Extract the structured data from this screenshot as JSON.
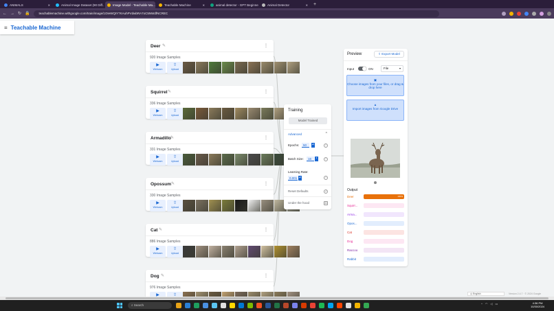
{
  "browser": {
    "tabs": [
      {
        "label": "ANIMALS",
        "active": false,
        "color": "#4285f4"
      },
      {
        "label": "Animal Image Dataset (90 Diff...",
        "active": false,
        "color": "#20beff"
      },
      {
        "label": "Image Model - Teachable Ma...",
        "active": true,
        "color": "#f4b400"
      },
      {
        "label": "Teachable Machine",
        "active": false,
        "color": "#f4b400"
      },
      {
        "label": "animal detector - GPT Beginne...",
        "active": false,
        "color": "#10a37f"
      },
      {
        "label": "Animal Detector",
        "active": false,
        "color": "#bbbbbb"
      }
    ],
    "new_tab": "+",
    "url": "teachablemachine.withgoogle.com/train/image/1OIeWQIY7KAuhPVdwbRA7oC5NWdfNCREC"
  },
  "app": {
    "title": "Teachable Machine",
    "menu_icon": "≡"
  },
  "classes": [
    {
      "name": "Deer",
      "count": "920 Image Samples",
      "thumbs": [
        "#6b5a44",
        "#8a7a5c",
        "#4e7a3a",
        "#6a8a4a",
        "#7a6a50",
        "#8b7355",
        "#9a8a6a",
        "#a09070",
        "#b0a080"
      ]
    },
    {
      "name": "Squirrel",
      "count": "336 Image Samples",
      "thumbs": [
        "#5a6a3a",
        "#7a5a3a",
        "#8a7a5a",
        "#6a5a40",
        "#a08a60",
        "#9a8a70",
        "#7a7a5a",
        "#b0a080",
        "#8a8a6a"
      ]
    },
    {
      "name": "Armadillo",
      "count": "331 Image Samples",
      "thumbs": [
        "#4a5a3a",
        "#6a5a4a",
        "#8a7a5a",
        "#5a6a4a",
        "#7a8a6a",
        "#4a4a4a",
        "#6a7a5a",
        "#3a4a3a",
        "#8a8070"
      ]
    },
    {
      "name": "Opossum",
      "count": "330 Image Samples",
      "thumbs": [
        "#5a5040",
        "#7a7060",
        "#a09050",
        "#7a7a3a",
        "#1a1a1a",
        "#f0f0f0",
        "#9a9080",
        "#c0b8a0",
        "#a0a090"
      ]
    },
    {
      "name": "Cat",
      "count": "886 Image Samples",
      "thumbs": [
        "#3a3a3a",
        "#a09080",
        "#c0b0a0",
        "#8a8070",
        "#b0a090",
        "#604a70",
        "#d0c0a0",
        "#b09030",
        "#a08060"
      ]
    },
    {
      "name": "Dog",
      "count": "976 Image Samples",
      "thumbs": [
        "#8a7050",
        "#a09070",
        "#6a5a40",
        "#c0a070",
        "#7a6a5a",
        "#9a8a6a",
        "#b0a080",
        "#8a7a5a",
        "#a09080"
      ]
    }
  ],
  "card_labels": {
    "webcam": "Webcam",
    "upload": "Upload",
    "webcam_icon": "video-camera-icon",
    "upload_icon": "upload-icon"
  },
  "training": {
    "title": "Training",
    "model_trained": "Model Trained",
    "advanced": "Advanced",
    "epochs_label": "Epochs:",
    "epochs_value": "50",
    "batch_label": "Batch Size:",
    "batch_value": "16",
    "lr_label": "Learning Rate:",
    "lr_value": "0.001",
    "reset": "Reset Defaults",
    "under_hood": "Under the hood"
  },
  "preview": {
    "title": "Preview",
    "export": "Export Model",
    "input_label": "Input",
    "on_label": "ON",
    "file_select": "File",
    "choose_text": "Choose images from your files, or drag & drop here",
    "drive_text": "Import images from Google Drive",
    "output_label": "Output",
    "outputs": [
      {
        "label": "Deer",
        "value": 100,
        "pct": "100%",
        "color": "#e8710a",
        "bg": "#fce8d5"
      },
      {
        "label": "Squirr...",
        "value": 0,
        "pct": "",
        "color": "#e52592",
        "bg": "#fde7f3"
      },
      {
        "label": "Arma...",
        "value": 0,
        "pct": "",
        "color": "#9334e6",
        "bg": "#f1e6fd"
      },
      {
        "label": "Opos...",
        "value": 0,
        "pct": "",
        "color": "#1967d2",
        "bg": "#e2edfd"
      },
      {
        "label": "Cat",
        "value": 0,
        "pct": "",
        "color": "#d93025",
        "bg": "#fce4e2"
      },
      {
        "label": "Dog",
        "value": 0,
        "pct": "",
        "color": "#e52592",
        "bg": "#fde7f3"
      },
      {
        "label": "Raccoo",
        "value": 0,
        "pct": "",
        "color": "#7b1fa2",
        "bg": "#f3e5f5"
      },
      {
        "label": "Rabbit",
        "value": 0,
        "pct": "",
        "color": "#1967d2",
        "bg": "#e2edfd"
      }
    ]
  },
  "footer": {
    "language": "English",
    "version": "Version 2.4.7 · © 2024 Google"
  },
  "taskbar": {
    "search": "Search",
    "clock_time": "4:36 PM",
    "clock_date": "10/30/2024",
    "icon_colors": [
      "#e8a317",
      "#2a7fd4",
      "#1e9e5e",
      "#4a90e2",
      "#5bc5f2",
      "#e0e0e0",
      "#ffd700",
      "#0078d4",
      "#7fba00",
      "#f25022",
      "#2b579a",
      "#217346",
      "#b7472a",
      "#7b83eb",
      "#d83b01",
      "#ea4335",
      "#1db954",
      "#00a4ef",
      "#ff4500",
      "#e0e0e0",
      "#f4b400",
      "#34a853"
    ]
  }
}
